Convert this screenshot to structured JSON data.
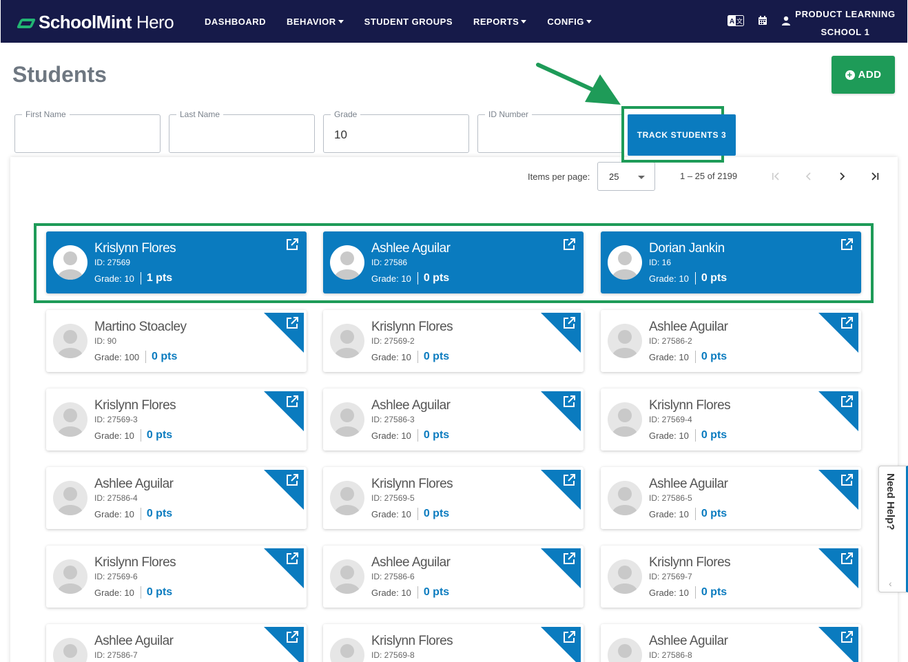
{
  "app": {
    "logo_bold": "SchoolMint",
    "logo_light": " Hero",
    "nav": [
      {
        "label": "DASHBOARD",
        "dropdown": false
      },
      {
        "label": "BEHAVIOR",
        "dropdown": true
      },
      {
        "label": "STUDENT GROUPS",
        "dropdown": false
      },
      {
        "label": "REPORTS",
        "dropdown": true
      },
      {
        "label": "CONFIG",
        "dropdown": true
      }
    ],
    "school_line1": "PRODUCT LEARNING",
    "school_line2": "SCHOOL 1"
  },
  "page": {
    "title": "Students",
    "add_label": "ADD",
    "track_label": "TRACK STUDENTS 3"
  },
  "filters": {
    "first_name": {
      "label": "First Name",
      "value": ""
    },
    "last_name": {
      "label": "Last Name",
      "value": ""
    },
    "grade": {
      "label": "Grade",
      "value": "10"
    },
    "id_number": {
      "label": "ID Number",
      "value": ""
    }
  },
  "pager": {
    "items_label": "Items per page:",
    "per_page": "25",
    "range": "1 – 25 of 2199"
  },
  "students": [
    {
      "name": "Krislynn Flores",
      "id": "ID: 27569",
      "grade": "Grade: 10",
      "pts": "1 pts",
      "selected": true
    },
    {
      "name": "Ashlee Aguilar",
      "id": "ID: 27586",
      "grade": "Grade: 10",
      "pts": "0 pts",
      "selected": true
    },
    {
      "name": "Dorian Jankin",
      "id": "ID: 16",
      "grade": "Grade: 10",
      "pts": "0 pts",
      "selected": true
    },
    {
      "name": "Martino Stoacley",
      "id": "ID: 90",
      "grade": "Grade: 100",
      "pts": "0 pts",
      "selected": false
    },
    {
      "name": "Krislynn Flores",
      "id": "ID: 27569-2",
      "grade": "Grade: 10",
      "pts": "0 pts",
      "selected": false
    },
    {
      "name": "Ashlee Aguilar",
      "id": "ID: 27586-2",
      "grade": "Grade: 10",
      "pts": "0 pts",
      "selected": false
    },
    {
      "name": "Krislynn Flores",
      "id": "ID: 27569-3",
      "grade": "Grade: 10",
      "pts": "0 pts",
      "selected": false
    },
    {
      "name": "Ashlee Aguilar",
      "id": "ID: 27586-3",
      "grade": "Grade: 10",
      "pts": "0 pts",
      "selected": false
    },
    {
      "name": "Krislynn Flores",
      "id": "ID: 27569-4",
      "grade": "Grade: 10",
      "pts": "0 pts",
      "selected": false
    },
    {
      "name": "Ashlee Aguilar",
      "id": "ID: 27586-4",
      "grade": "Grade: 10",
      "pts": "0 pts",
      "selected": false
    },
    {
      "name": "Krislynn Flores",
      "id": "ID: 27569-5",
      "grade": "Grade: 10",
      "pts": "0 pts",
      "selected": false
    },
    {
      "name": "Ashlee Aguilar",
      "id": "ID: 27586-5",
      "grade": "Grade: 10",
      "pts": "0 pts",
      "selected": false
    },
    {
      "name": "Krislynn Flores",
      "id": "ID: 27569-6",
      "grade": "Grade: 10",
      "pts": "0 pts",
      "selected": false
    },
    {
      "name": "Ashlee Aguilar",
      "id": "ID: 27586-6",
      "grade": "Grade: 10",
      "pts": "0 pts",
      "selected": false
    },
    {
      "name": "Krislynn Flores",
      "id": "ID: 27569-7",
      "grade": "Grade: 10",
      "pts": "0 pts",
      "selected": false
    },
    {
      "name": "Ashlee Aguilar",
      "id": "ID: 27586-7",
      "grade": "",
      "pts": "",
      "selected": false
    },
    {
      "name": "Krislynn Flores",
      "id": "ID: 27569-8",
      "grade": "",
      "pts": "",
      "selected": false
    },
    {
      "name": "Ashlee Aguilar",
      "id": "ID: 27586-8",
      "grade": "",
      "pts": "",
      "selected": false
    }
  ],
  "help": {
    "label": "Need Help?"
  },
  "colors": {
    "nav_bg": "#161a49",
    "primary": "#0a7bbf",
    "accent_green": "#1e9b58"
  }
}
